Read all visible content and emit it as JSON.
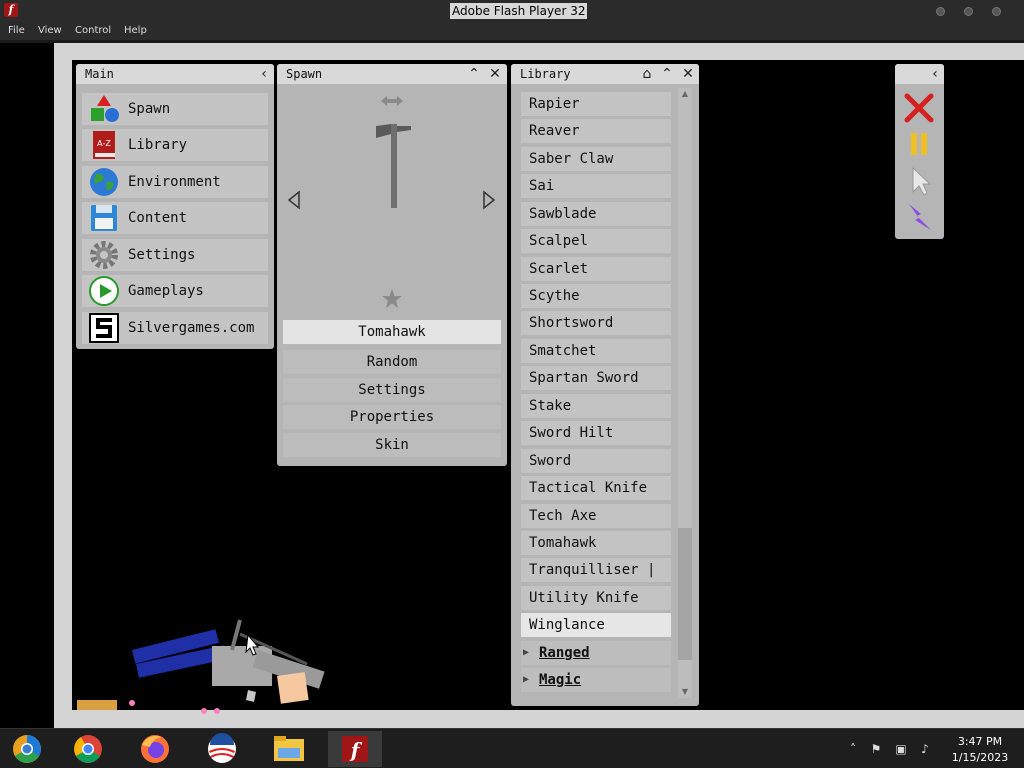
{
  "window": {
    "title": "Adobe Flash Player 32",
    "menu": [
      "File",
      "View",
      "Control",
      "Help"
    ]
  },
  "main_panel": {
    "title": "Main",
    "items": [
      {
        "label": "Spawn",
        "icon": "shapes-icon"
      },
      {
        "label": "Library",
        "icon": "book-a-z-icon"
      },
      {
        "label": "Environment",
        "icon": "globe-icon"
      },
      {
        "label": "Content",
        "icon": "floppy-disk-icon"
      },
      {
        "label": "Settings",
        "icon": "gear-icon"
      },
      {
        "label": "Gameplays",
        "icon": "play-icon"
      },
      {
        "label": "Silvergames.com",
        "icon": "silvergames-logo-icon"
      }
    ]
  },
  "spawn_panel": {
    "title": "Spawn",
    "selected_item": "Tomahawk",
    "buttons": [
      "Random",
      "Settings",
      "Properties",
      "Skin"
    ]
  },
  "library_panel": {
    "title": "Library",
    "items": [
      "Rapier",
      "Reaver",
      "Saber Claw",
      "Sai",
      "Sawblade",
      "Scalpel",
      "Scarlet",
      "Scythe",
      "Shortsword",
      "Smatchet",
      "Spartan Sword",
      "Stake",
      "Sword Hilt",
      "Sword",
      "Tactical Knife",
      "Tech Axe",
      "Tomahawk",
      "Tranquilliser |",
      "Utility Knife",
      "Winglance"
    ],
    "selected": "Winglance",
    "categories": [
      "Ranged",
      "Magic"
    ]
  },
  "tools_panel": {
    "tools": [
      "clear-x-icon",
      "pause-icon",
      "cursor-icon",
      "lightning-icon"
    ]
  },
  "taskbar": {
    "apps": [
      "chrome-canary-icon",
      "chrome-icon",
      "firefox-icon",
      "obama-logo-icon",
      "file-explorer-icon",
      "flash-player-icon"
    ],
    "time": "3:47 PM",
    "date": "1/15/2023"
  }
}
